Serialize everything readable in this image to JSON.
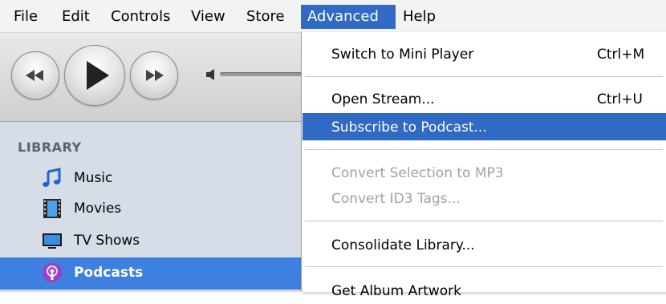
{
  "menubar": {
    "items": [
      {
        "label": "File"
      },
      {
        "label": "Edit"
      },
      {
        "label": "Controls"
      },
      {
        "label": "View"
      },
      {
        "label": "Store"
      },
      {
        "label": "Advanced",
        "active": true
      },
      {
        "label": "Help"
      }
    ]
  },
  "toolbar": {
    "buttons": [
      "previous-track",
      "play",
      "next-track"
    ],
    "volume_icon": "speaker-icon"
  },
  "sidebar": {
    "header": "LIBRARY",
    "items": [
      {
        "label": "Music",
        "icon": "music-note-icon"
      },
      {
        "label": "Movies",
        "icon": "film-icon"
      },
      {
        "label": "TV Shows",
        "icon": "tv-icon"
      },
      {
        "label": "Podcasts",
        "icon": "podcast-icon",
        "selected": true
      }
    ]
  },
  "dropdown": {
    "items": [
      {
        "label": "Switch to Mini Player",
        "shortcut": "Ctrl+M",
        "enabled": true
      },
      {
        "label": "Open Stream...",
        "shortcut": "Ctrl+U",
        "enabled": true
      },
      {
        "label": "Subscribe to Podcast...",
        "enabled": true,
        "highlighted": true
      },
      {
        "label": "Convert Selection to MP3",
        "enabled": false
      },
      {
        "label": "Convert ID3 Tags...",
        "enabled": false
      },
      {
        "label": "Consolidate Library...",
        "enabled": true
      },
      {
        "label": "Get Album Artwork",
        "enabled": true
      }
    ]
  },
  "colors": {
    "highlight": "#316ac5",
    "sidebar_bg": "#d6dde6",
    "sidebar_selected": "#3d80df",
    "disabled_text": "#a2a2a2"
  }
}
